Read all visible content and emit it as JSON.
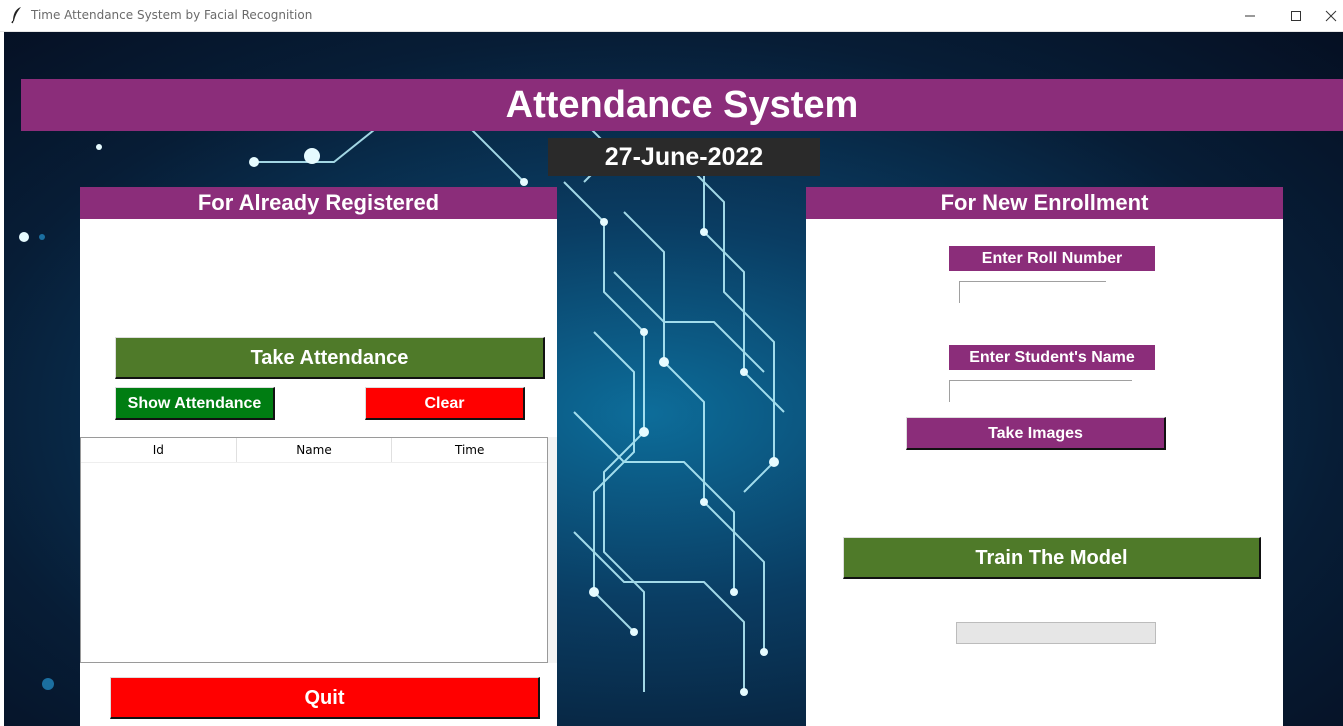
{
  "window": {
    "title": "Time Attendance System by Facial Recognition",
    "icon": "feather-icon",
    "controls": [
      "minimize-icon",
      "maximize-icon",
      "close-icon"
    ]
  },
  "header": {
    "title": "Attendance System",
    "date": "27-June-2022"
  },
  "registered": {
    "heading": "For Already Registered",
    "take_attendance": "Take Attendance",
    "show_attendance": "Show Attendance",
    "clear": "Clear",
    "table": {
      "columns": [
        "Id",
        "Name",
        "Time"
      ],
      "rows": []
    },
    "quit": "Quit"
  },
  "enrollment": {
    "heading": "For New Enrollment",
    "roll_label": "Enter Roll Number",
    "roll_value": "",
    "name_label": "Enter Student's Name",
    "name_value": "",
    "take_images": "Take Images",
    "train_model": "Train The Model",
    "progress": 0
  },
  "colors": {
    "header_purple": "#8b2d7a",
    "green_button": "#4f7a29",
    "show_green": "#007d12",
    "red_button": "#ff0000",
    "date_bg": "#2a2a2a"
  }
}
